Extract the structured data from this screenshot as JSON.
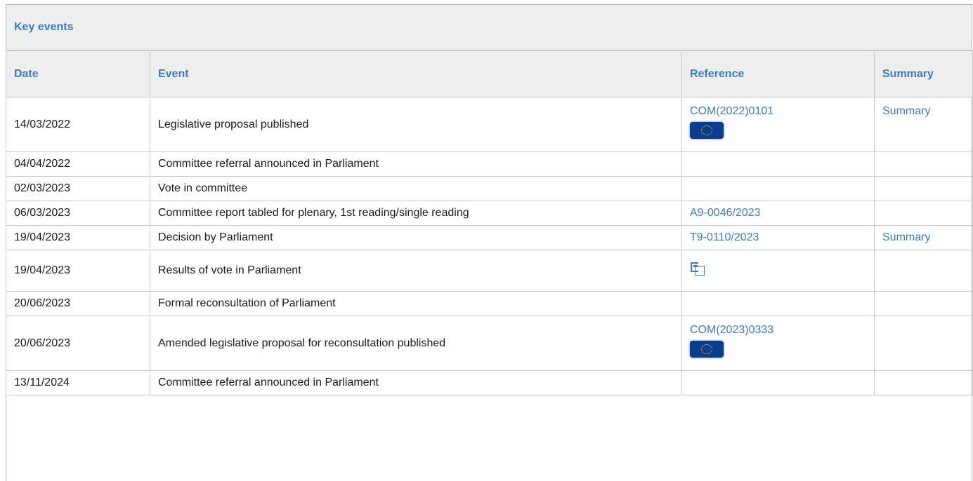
{
  "panel": {
    "title": "Key events"
  },
  "columns": {
    "date": "Date",
    "event": "Event",
    "reference": "Reference",
    "summary": "Summary"
  },
  "rows": [
    {
      "date": "14/03/2022",
      "event": "Legislative proposal published",
      "reference": "COM(2022)0101",
      "reference_icon": "eu-flag-icon",
      "summary": "Summary"
    },
    {
      "date": "04/04/2022",
      "event": "Committee referral announced in Parliament",
      "reference": "",
      "summary": ""
    },
    {
      "date": "02/03/2023",
      "event": "Vote in committee",
      "reference": "",
      "summary": ""
    },
    {
      "date": "06/03/2023",
      "event": "Committee report tabled for plenary, 1st reading/single reading",
      "reference": "A9-0046/2023",
      "summary": ""
    },
    {
      "date": "19/04/2023",
      "event": "Decision by Parliament",
      "reference": "T9-0110/2023",
      "summary": "Summary"
    },
    {
      "date": "19/04/2023",
      "event": "Results of vote in Parliament",
      "reference": "",
      "reference_icon": "vote-results-icon",
      "summary": ""
    },
    {
      "date": "20/06/2023",
      "event": "Formal reconsultation of Parliament",
      "reference": "",
      "summary": ""
    },
    {
      "date": "20/06/2023",
      "event": "Amended legislative proposal for reconsultation published",
      "reference": "COM(2023)0333",
      "reference_icon": "eu-flag-icon",
      "summary": ""
    },
    {
      "date": "13/11/2024",
      "event": "Committee referral announced in Parliament",
      "reference": "",
      "summary": ""
    }
  ],
  "colors": {
    "link": "#3c7cc4",
    "header_bg": "#eeeeee",
    "border": "#c8c8c8",
    "flag": "#0b3d8f"
  }
}
